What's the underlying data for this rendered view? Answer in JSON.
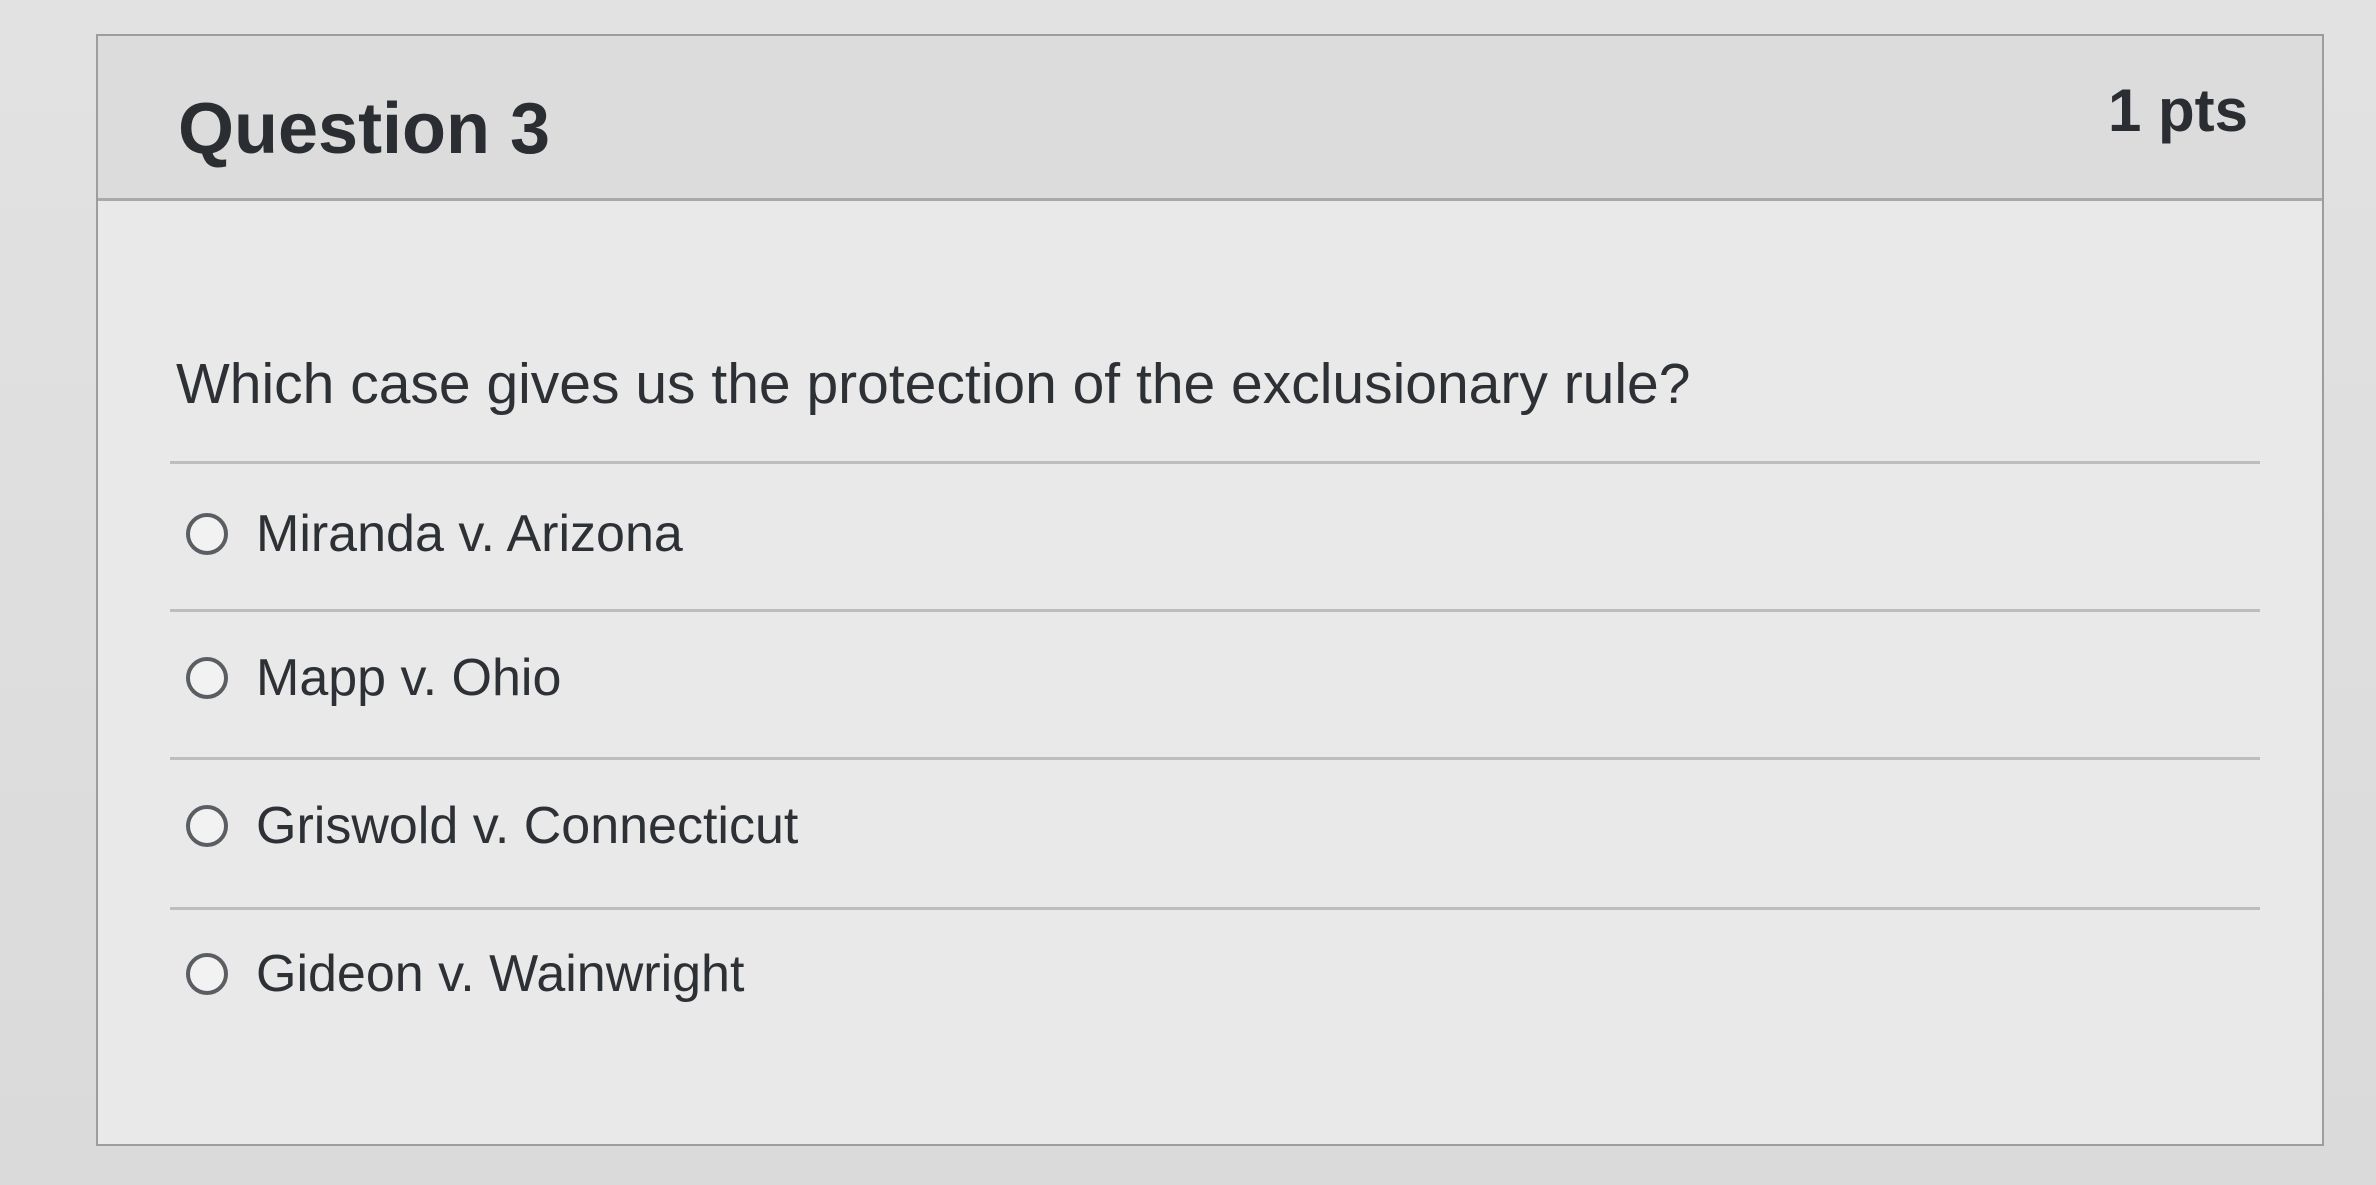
{
  "question": {
    "title": "Question 3",
    "points": "1 pts",
    "text": "Which case gives us the protection of the exclusionary rule?",
    "answers": [
      {
        "label": "Miranda v. Arizona"
      },
      {
        "label": "Mapp v. Ohio"
      },
      {
        "label": "Griswold v. Connecticut"
      },
      {
        "label": "Gideon v. Wainwright"
      }
    ]
  }
}
